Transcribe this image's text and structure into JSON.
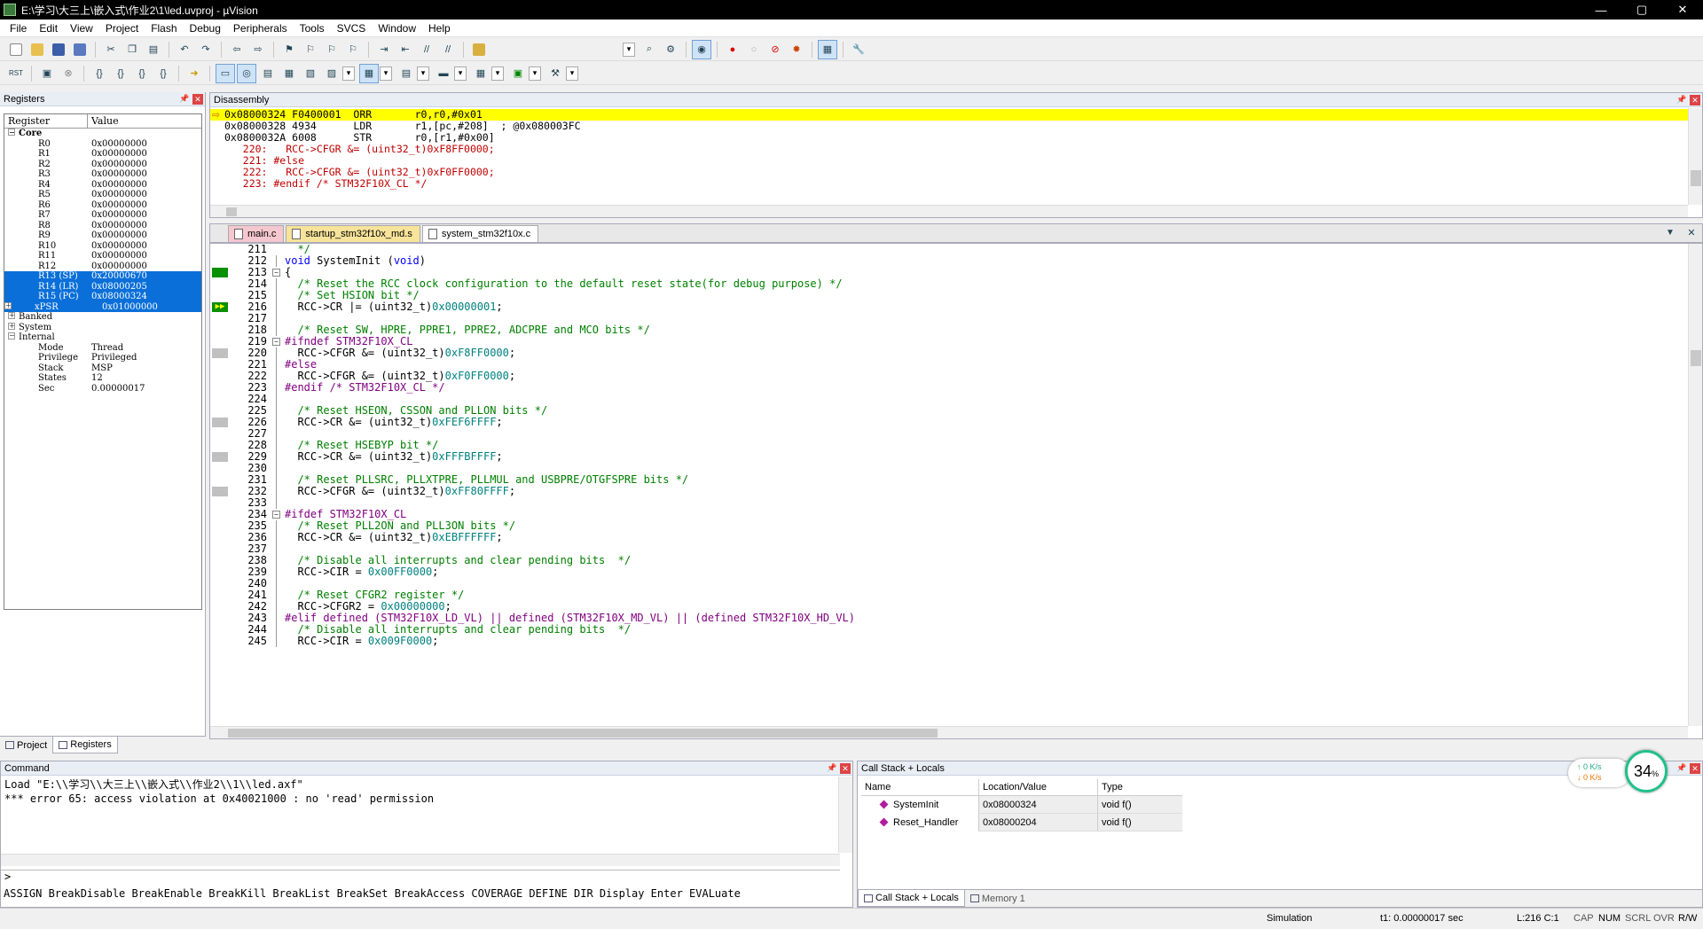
{
  "window": {
    "title": "E:\\学习\\大三上\\嵌入式\\作业2\\1\\led.uvproj - µVision",
    "min": "—",
    "max": "▢",
    "close": "✕"
  },
  "menu": [
    "File",
    "Edit",
    "View",
    "Project",
    "Flash",
    "Debug",
    "Peripherals",
    "Tools",
    "SVCS",
    "Window",
    "Help"
  ],
  "registers": {
    "title": "Registers",
    "col_register": "Register",
    "col_value": "Value",
    "core_label": "Core",
    "rows": [
      {
        "n": "R0",
        "v": "0x00000000"
      },
      {
        "n": "R1",
        "v": "0x00000000"
      },
      {
        "n": "R2",
        "v": "0x00000000"
      },
      {
        "n": "R3",
        "v": "0x00000000"
      },
      {
        "n": "R4",
        "v": "0x00000000"
      },
      {
        "n": "R5",
        "v": "0x00000000"
      },
      {
        "n": "R6",
        "v": "0x00000000"
      },
      {
        "n": "R7",
        "v": "0x00000000"
      },
      {
        "n": "R8",
        "v": "0x00000000"
      },
      {
        "n": "R9",
        "v": "0x00000000"
      },
      {
        "n": "R10",
        "v": "0x00000000"
      },
      {
        "n": "R11",
        "v": "0x00000000"
      },
      {
        "n": "R12",
        "v": "0x00000000"
      },
      {
        "n": "R13 (SP)",
        "v": "0x20000670"
      },
      {
        "n": "R14 (LR)",
        "v": "0x08000205"
      },
      {
        "n": "R15 (PC)",
        "v": "0x08000324"
      },
      {
        "n": "xPSR",
        "v": "0x01000000"
      }
    ],
    "groups": [
      "Banked",
      "System",
      "Internal"
    ],
    "internal": [
      {
        "n": "Mode",
        "v": "Thread"
      },
      {
        "n": "Privilege",
        "v": "Privileged"
      },
      {
        "n": "Stack",
        "v": "MSP"
      },
      {
        "n": "States",
        "v": "12"
      },
      {
        "n": "Sec",
        "v": "0.00000017"
      }
    ],
    "tabs": [
      "Project",
      "Registers"
    ]
  },
  "disassembly": {
    "title": "Disassembly",
    "lines": [
      "0x08000324 F0400001  ORR       r0,r0,#0x01",
      "0x08000328 4934      LDR       r1,[pc,#208]  ; @0x080003FC",
      "0x0800032A 6008      STR       r0,[r1,#0x00]",
      "   220:   RCC->CFGR &= (uint32_t)0xF8FF0000;",
      "   221: #else",
      "   222:   RCC->CFGR &= (uint32_t)0xF0FF0000;",
      "   223: #endif /* STM32F10X_CL */"
    ]
  },
  "editor": {
    "tabs": [
      "main.c",
      "startup_stm32f10x_md.s",
      "system_stm32f10x.c"
    ],
    "lines": [
      {
        "n": "211",
        "t": "  */",
        "k": "cm"
      },
      {
        "n": "212",
        "t": "void SystemInit (void)"
      },
      {
        "n": "213",
        "t": "{",
        "g": "green",
        "f": "−"
      },
      {
        "n": "214",
        "t": "  /* Reset the RCC clock configuration to the default reset state(for debug purpose) */",
        "k": "cm"
      },
      {
        "n": "215",
        "t": "  /* Set HSION bit */",
        "k": "cm"
      },
      {
        "n": "216",
        "t": "  RCC->CR |= (uint32_t)0x00000001;",
        "g": "arrow"
      },
      {
        "n": "217",
        "t": ""
      },
      {
        "n": "218",
        "t": "  /* Reset SW, HPRE, PPRE1, PPRE2, ADCPRE and MCO bits */",
        "k": "cm"
      },
      {
        "n": "219",
        "t": "#ifndef STM32F10X_CL",
        "k": "pp",
        "f": "−"
      },
      {
        "n": "220",
        "t": "  RCC->CFGR &= (uint32_t)0xF8FF0000;",
        "g": "gray"
      },
      {
        "n": "221",
        "t": "#else",
        "k": "pp"
      },
      {
        "n": "222",
        "t": "  RCC->CFGR &= (uint32_t)0xF0FF0000;"
      },
      {
        "n": "223",
        "t": "#endif /* STM32F10X_CL */",
        "k": "pp"
      },
      {
        "n": "224",
        "t": ""
      },
      {
        "n": "225",
        "t": "  /* Reset HSEON, CSSON and PLLON bits */",
        "k": "cm"
      },
      {
        "n": "226",
        "t": "  RCC->CR &= (uint32_t)0xFEF6FFFF;",
        "g": "gray"
      },
      {
        "n": "227",
        "t": ""
      },
      {
        "n": "228",
        "t": "  /* Reset HSEBYP bit */",
        "k": "cm"
      },
      {
        "n": "229",
        "t": "  RCC->CR &= (uint32_t)0xFFFBFFFF;",
        "g": "gray"
      },
      {
        "n": "230",
        "t": ""
      },
      {
        "n": "231",
        "t": "  /* Reset PLLSRC, PLLXTPRE, PLLMUL and USBPRE/OTGFSPRE bits */",
        "k": "cm"
      },
      {
        "n": "232",
        "t": "  RCC->CFGR &= (uint32_t)0xFF80FFFF;",
        "g": "gray"
      },
      {
        "n": "233",
        "t": ""
      },
      {
        "n": "234",
        "t": "#ifdef STM32F10X_CL",
        "k": "pp",
        "f": "−"
      },
      {
        "n": "235",
        "t": "  /* Reset PLL2ON and PLL3ON bits */",
        "k": "cm"
      },
      {
        "n": "236",
        "t": "  RCC->CR &= (uint32_t)0xEBFFFFFF;"
      },
      {
        "n": "237",
        "t": ""
      },
      {
        "n": "238",
        "t": "  /* Disable all interrupts and clear pending bits  */",
        "k": "cm"
      },
      {
        "n": "239",
        "t": "  RCC->CIR = 0x00FF0000;"
      },
      {
        "n": "240",
        "t": ""
      },
      {
        "n": "241",
        "t": "  /* Reset CFGR2 register */",
        "k": "cm"
      },
      {
        "n": "242",
        "t": "  RCC->CFGR2 = 0x00000000;"
      },
      {
        "n": "243",
        "t": "#elif defined (STM32F10X_LD_VL) || defined (STM32F10X_MD_VL) || (defined STM32F10X_HD_VL)",
        "k": "pp"
      },
      {
        "n": "244",
        "t": "  /* Disable all interrupts and clear pending bits  */",
        "k": "cm"
      },
      {
        "n": "245",
        "t": "  RCC->CIR = 0x009F0000;"
      }
    ]
  },
  "command": {
    "title": "Command",
    "lines": [
      "Load \"E:\\\\学习\\\\大三上\\\\嵌入式\\\\作业2\\\\1\\\\led.axf\"",
      "*** error 65: access violation at 0x40021000 : no 'read' permission"
    ],
    "prompt": ">",
    "help": "ASSIGN BreakDisable BreakEnable BreakKill BreakList BreakSet BreakAccess COVERAGE DEFINE DIR Display Enter EVALuate"
  },
  "callstack": {
    "title": "Call Stack + Locals",
    "cols": [
      "Name",
      "Location/Value",
      "Type"
    ],
    "rows": [
      {
        "name": "SystemInit",
        "loc": "0x08000324",
        "type": "void f()"
      },
      {
        "name": "Reset_Handler",
        "loc": "0x08000204",
        "type": "void f()"
      }
    ],
    "tabs": [
      "Call Stack + Locals",
      "Memory 1"
    ]
  },
  "status": {
    "mode": "Simulation",
    "time": "t1: 0.00000017 sec",
    "pos": "L:216 C:1",
    "caps": "CAP",
    "num": "NUM",
    "scrl": "SCRL",
    "ovr": "OVR",
    "rw": "R/W"
  },
  "perf": {
    "up": "0  K/s",
    "down": "0  K/s",
    "percent": "34",
    "pct_sign": "%"
  },
  "colors": {
    "current_line": "#ffff00",
    "selection": "#0a6fd8",
    "comment": "#008000",
    "keyword": "#0000ff",
    "preproc": "#800080",
    "number": "#008080"
  }
}
